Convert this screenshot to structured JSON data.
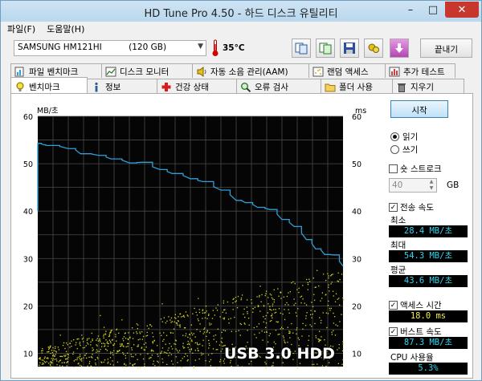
{
  "window": {
    "title": "HD Tune Pro 4.50 - 하드 디스크 유틸리티",
    "minimize": "–",
    "maximize": "□",
    "close": "✕"
  },
  "menu": [
    "파일(F)",
    "도움말(H)"
  ],
  "toolbar": {
    "drive": "SAMSUNG HM121HI          (120 GB)",
    "temperature": "35°C",
    "exit_label": "끝내기",
    "icons": [
      "copy-info-icon",
      "copy-screenshot-icon",
      "save-icon",
      "options-icon",
      "download-icon"
    ]
  },
  "tabs_row1": [
    {
      "label": "파일 벤치마크",
      "icon": "file-benchmark-icon"
    },
    {
      "label": "디스크 모니터",
      "icon": "disk-monitor-icon"
    },
    {
      "label": "자동 소음 관리(AAM)",
      "icon": "speaker-icon"
    },
    {
      "label": "랜덤 액세스",
      "icon": "random-access-icon"
    },
    {
      "label": "추가 테스트",
      "icon": "extra-tests-icon"
    }
  ],
  "tabs_row2": [
    {
      "label": "벤치마크",
      "icon": "benchmark-icon",
      "active": true
    },
    {
      "label": "정보",
      "icon": "info-icon"
    },
    {
      "label": "건강 상태",
      "icon": "health-icon"
    },
    {
      "label": "오류 검사",
      "icon": "error-scan-icon"
    },
    {
      "label": "폴더 사용",
      "icon": "folder-usage-icon"
    },
    {
      "label": "지우기",
      "icon": "erase-icon"
    }
  ],
  "controls": {
    "start_label": "시작",
    "read_label": "읽기",
    "write_label": "쓰기",
    "mode_selected": "읽기",
    "short_stroke_label": "숏 스트로크",
    "short_stroke_checked": false,
    "short_stroke_value": "40",
    "short_stroke_unit": "GB",
    "transfer_rate_label": "전송 속도",
    "transfer_rate_checked": true,
    "min_label": "최소",
    "min_value": "28.4 MB/초",
    "max_label": "최대",
    "max_value": "54.3 MB/초",
    "avg_label": "평균",
    "avg_value": "43.6 MB/초",
    "access_time_label": "액세스 시간",
    "access_time_checked": true,
    "access_time_value": "18.0 ms",
    "burst_rate_label": "버스트 속도",
    "burst_rate_checked": true,
    "burst_rate_value": "87.3 MB/초",
    "cpu_label": "CPU 사용율",
    "cpu_value": "5.3%"
  },
  "overlay_text": "USB 3.0 HDD",
  "chart_data": {
    "type": "line",
    "ylabel_left": "MB/초",
    "ylabel_right": "ms",
    "ylim_left": [
      0,
      60
    ],
    "ylim_right": [
      0,
      60
    ],
    "left_ticks": [
      "60",
      "50",
      "40",
      "30",
      "20",
      "10"
    ],
    "right_ticks": [
      "60",
      "50",
      "40",
      "30",
      "20",
      "10"
    ],
    "grid": true,
    "x_divisions": 20,
    "series": [
      {
        "color": "#2d9fd9",
        "x": [
          0,
          2,
          3,
          10,
          14,
          20,
          24,
          30,
          34,
          40,
          44,
          50,
          54,
          60,
          65,
          68,
          72,
          76,
          80,
          84,
          88,
          91,
          94,
          97,
          100
        ],
        "values": [
          54.3,
          54.0,
          53.8,
          53.5,
          52.3,
          51.8,
          51.0,
          50.5,
          50.0,
          48.7,
          48.0,
          47.0,
          46.0,
          44.3,
          42.6,
          41.8,
          41.0,
          40.2,
          38.5,
          36.7,
          34.0,
          32.3,
          31.2,
          30.4,
          28.4
        ]
      }
    ],
    "scatter_series": {
      "color": "#d8d820",
      "description_values_ms": {
        "min": 7,
        "max": 28,
        "typical": 18.0
      }
    }
  }
}
